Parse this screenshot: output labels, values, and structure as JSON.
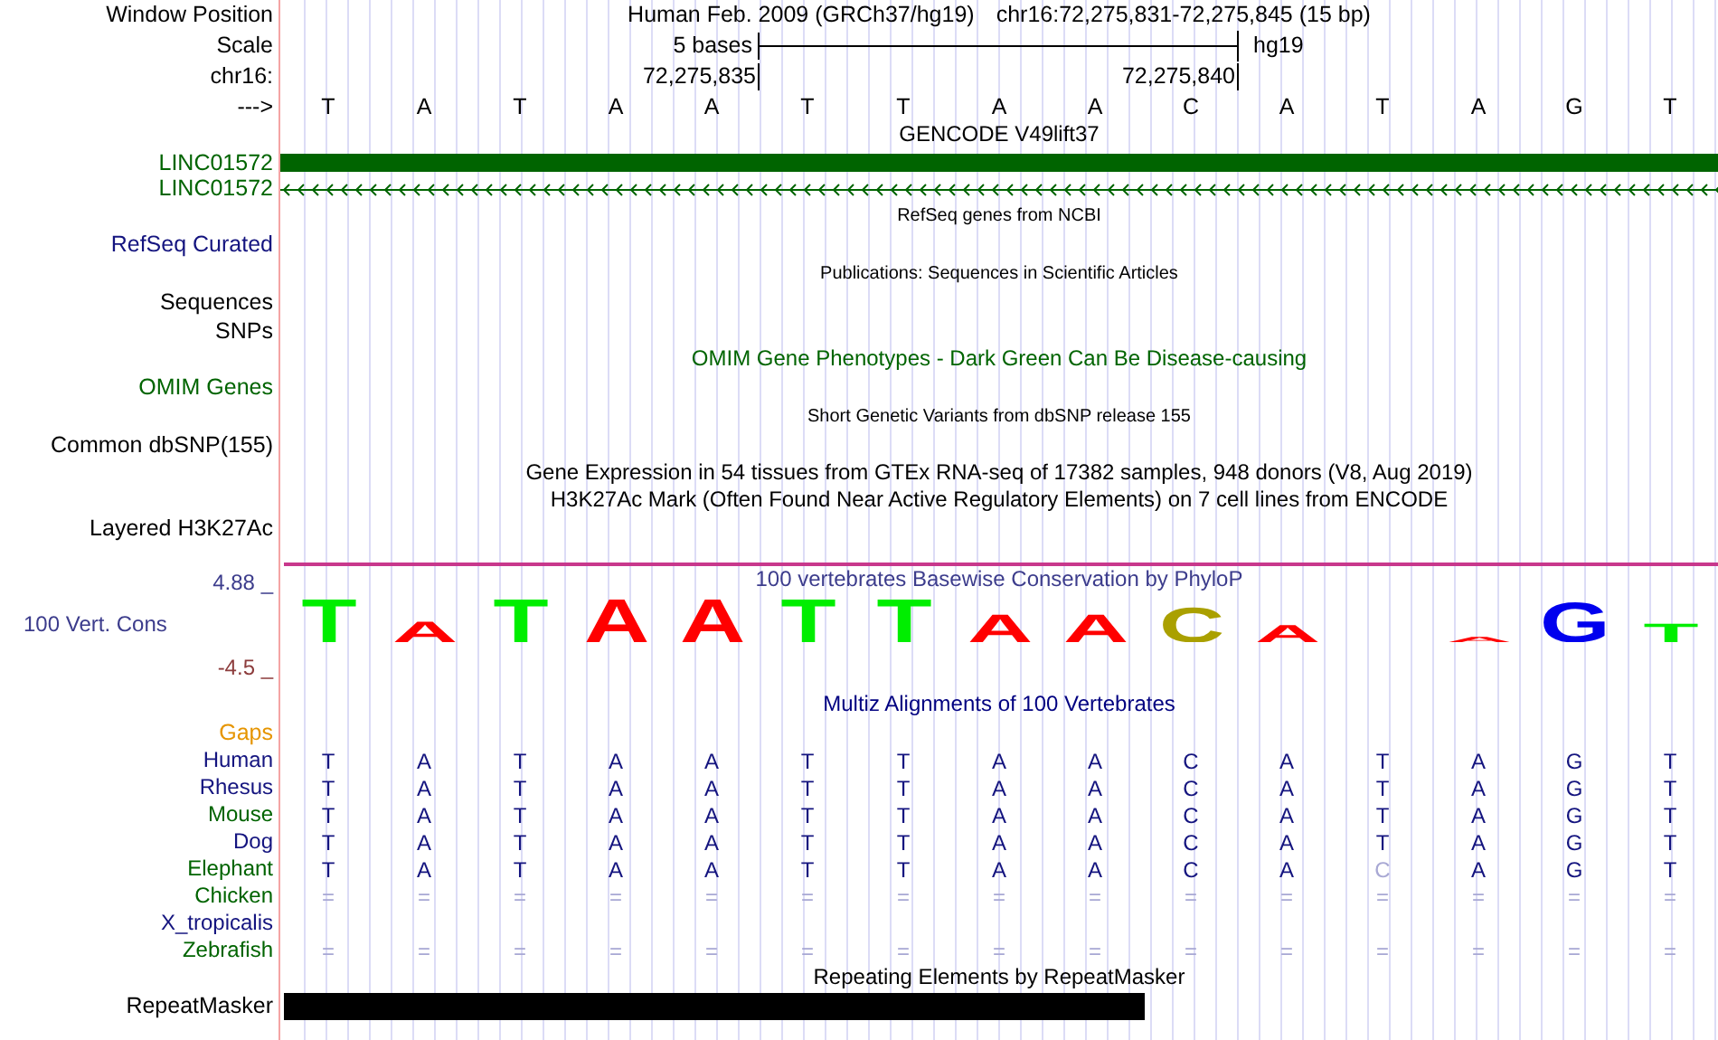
{
  "rows": [
    {
      "kind": "position",
      "label": "Window Position",
      "assembly": "Human Feb. 2009 (GRCh37/hg19)",
      "range": "chr16:72,275,831-72,275,845 (15 bp)"
    },
    {
      "kind": "scale",
      "label": "Scale",
      "span": "5 bases",
      "assembly": "hg19"
    },
    {
      "kind": "ruler",
      "label": "chr16:",
      "ticks": [
        "72,275,835",
        "72,275,840"
      ]
    },
    {
      "kind": "bases",
      "label": "--->",
      "bases": [
        "T",
        "A",
        "T",
        "A",
        "A",
        "T",
        "T",
        "A",
        "A",
        "C",
        "A",
        "T",
        "A",
        "G",
        "T"
      ]
    },
    {
      "kind": "caption",
      "text": "GENCODE V49lift37",
      "color": "#000000"
    },
    {
      "kind": "gene_block",
      "label": "LINC01572",
      "color": "#006400"
    },
    {
      "kind": "gene_arrows",
      "label": "LINC01572",
      "color": "#006400"
    },
    {
      "kind": "note",
      "text": "RefSeq genes from NCBI"
    },
    {
      "kind": "track",
      "label": "RefSeq Curated",
      "color": "#14147f"
    },
    {
      "kind": "note",
      "text": "Publications: Sequences in Scientific Articles"
    },
    {
      "kind": "track",
      "label": "Sequences",
      "color": "#000000"
    },
    {
      "kind": "track",
      "label": "SNPs",
      "color": "#000000"
    },
    {
      "kind": "caption",
      "text": "OMIM Gene Phenotypes - Dark Green Can Be Disease-causing",
      "color": "#006400"
    },
    {
      "kind": "track",
      "label": "OMIM Genes",
      "color": "#006400"
    },
    {
      "kind": "note",
      "text": "Short Genetic Variants from dbSNP release 155"
    },
    {
      "kind": "track",
      "label": "Common dbSNP(155)",
      "color": "#000000"
    },
    {
      "kind": "caption",
      "text": "Gene Expression in 54 tissues from GTEx RNA-seq of 17382 samples, 948 donors (V8, Aug 2019)",
      "color": "#000000"
    },
    {
      "kind": "caption",
      "text": "H3K27Ac Mark (Often Found Near Active Regulatory Elements) on 7 cell lines from ENCODE",
      "color": "#000000"
    },
    {
      "kind": "track",
      "label": "Layered H3K27Ac",
      "color": "#000000"
    },
    {
      "kind": "conservation",
      "label": "100 Vert. Cons",
      "max": "4.88 _",
      "min": "-4.5 _",
      "caption": "100 vertebrates Basewise Conservation by PhyloP",
      "logo": [
        {
          "kind": "letter",
          "base": "T",
          "color": "#00ee00"
        },
        {
          "kind": "letter",
          "base": "A",
          "color": "#ff0000"
        },
        {
          "kind": "letter",
          "base": "T",
          "color": "#00ee00"
        },
        {
          "kind": "letter",
          "base": "A",
          "color": "#ff0000"
        },
        {
          "kind": "letter",
          "base": "A",
          "color": "#ff0000"
        },
        {
          "kind": "letter",
          "base": "T",
          "color": "#00ee00"
        },
        {
          "kind": "letter",
          "base": "T",
          "color": "#00ee00"
        },
        {
          "kind": "letter",
          "base": "A",
          "color": "#ff0000"
        },
        {
          "kind": "letter",
          "base": "A",
          "color": "#ff0000"
        },
        {
          "kind": "letter",
          "base": "C",
          "color": "#aaa000"
        },
        {
          "kind": "letter",
          "base": "A",
          "color": "#ff0000"
        },
        {
          "kind": "blank"
        },
        {
          "kind": "letter",
          "base": "A",
          "color": "#ff0000"
        },
        {
          "kind": "letter",
          "base": "G",
          "color": "#0000ee"
        },
        {
          "kind": "letter",
          "base": "T",
          "color": "#00ee00"
        }
      ]
    },
    {
      "kind": "caption",
      "text": "Multiz Alignments of 100 Vertebrates",
      "color": "#000080"
    },
    {
      "kind": "track",
      "label": "Gaps",
      "color": "#e69500"
    },
    {
      "kind": "species",
      "label": "Human",
      "color": "#14147f",
      "faint": false,
      "bases": [
        "T",
        "A",
        "T",
        "A",
        "A",
        "T",
        "T",
        "A",
        "A",
        "C",
        "A",
        "T",
        "A",
        "G",
        "T"
      ]
    },
    {
      "kind": "species",
      "label": "Rhesus",
      "color": "#14147f",
      "faint": false,
      "bases": [
        "T",
        "A",
        "T",
        "A",
        "A",
        "T",
        "T",
        "A",
        "A",
        "C",
        "A",
        "T",
        "A",
        "G",
        "T"
      ]
    },
    {
      "kind": "species",
      "label": "Mouse",
      "color": "#006400",
      "faint": false,
      "bases": [
        "T",
        "A",
        "T",
        "A",
        "A",
        "T",
        "T",
        "A",
        "A",
        "C",
        "A",
        "T",
        "A",
        "G",
        "T"
      ]
    },
    {
      "kind": "species",
      "label": "Dog",
      "color": "#14147f",
      "faint": false,
      "bases": [
        "T",
        "A",
        "T",
        "A",
        "A",
        "T",
        "T",
        "A",
        "A",
        "C",
        "A",
        "T",
        "A",
        "G",
        "T"
      ]
    },
    {
      "kind": "species",
      "label": "Elephant",
      "color": "#006400",
      "faint": false,
      "bases": [
        "T",
        "A",
        "T",
        "A",
        "A",
        "T",
        "T",
        "A",
        "A",
        "C",
        "A",
        {
          "base": "C",
          "faint": true
        },
        "A",
        "G",
        "T"
      ]
    },
    {
      "kind": "species",
      "label": "Chicken",
      "color": "#006400",
      "faint": true,
      "bases": [
        "=",
        "=",
        "=",
        "=",
        "=",
        "=",
        "=",
        "=",
        "=",
        "=",
        "=",
        "=",
        "=",
        "=",
        "="
      ]
    },
    {
      "kind": "species",
      "label": "X_tropicalis",
      "color": "#14147f"
    },
    {
      "kind": "species",
      "label": "Zebrafish",
      "color": "#006400",
      "faint": true,
      "bases": [
        "=",
        "=",
        "=",
        "=",
        "=",
        "=",
        "=",
        "=",
        "=",
        "=",
        "=",
        "=",
        "=",
        "=",
        "="
      ]
    },
    {
      "kind": "caption",
      "text": "Repeating Elements by RepeatMasker",
      "color": "#000000"
    },
    {
      "kind": "repeat",
      "label": "RepeatMasker",
      "color": "#000000"
    }
  ]
}
